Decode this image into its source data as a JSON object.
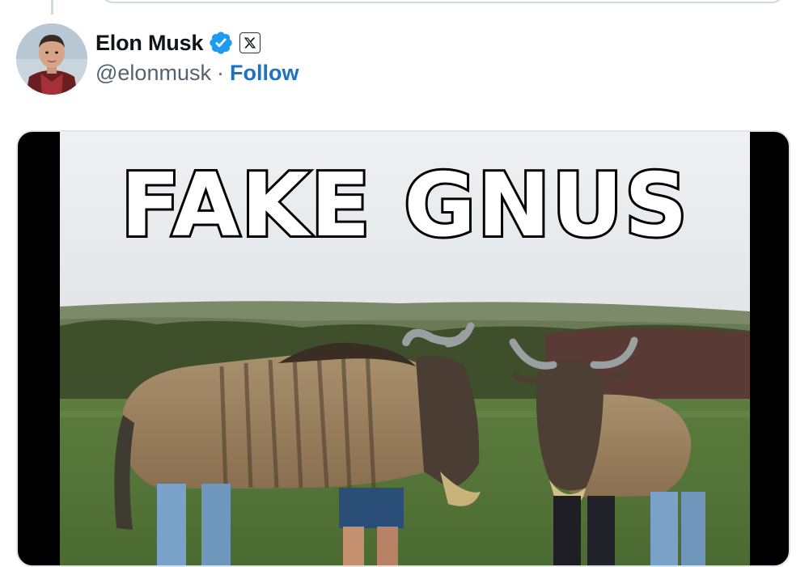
{
  "tweet": {
    "author": {
      "display_name": "Elon Musk",
      "handle": "@elonmusk",
      "separator": "·",
      "follow_label": "Follow",
      "verified_badge_icon": "verified-check-icon",
      "affiliate_icon": "x-logo-icon",
      "verified_color": "#1d9bf0"
    },
    "media": {
      "caption_text": "FAKE GNUS"
    }
  },
  "colors": {
    "link": "#1d72c4",
    "secondary_text": "#536471",
    "primary_text": "#0f1419"
  }
}
